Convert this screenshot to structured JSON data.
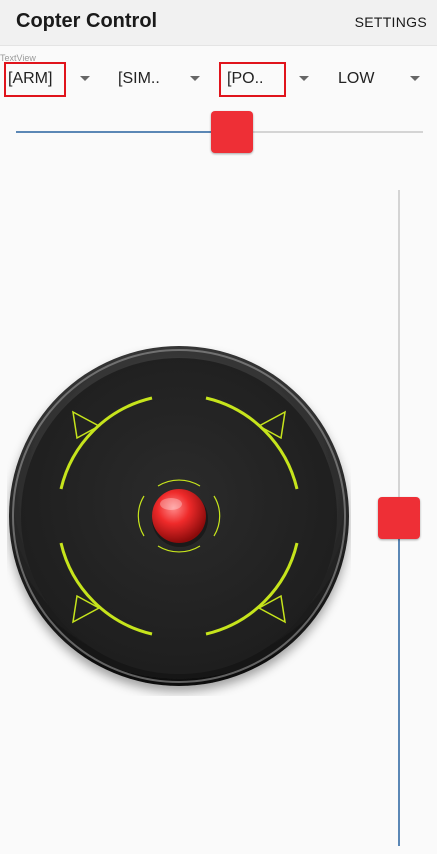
{
  "app_bar": {
    "title": "Copter Control",
    "settings_label": "SETTINGS"
  },
  "debug_label": "TextView",
  "spinners": [
    {
      "value": "[ARM]"
    },
    {
      "value": "[SIM.."
    },
    {
      "value": "[PO.."
    },
    {
      "value": "LOW"
    }
  ],
  "throttle_slider": {
    "value_fraction": 0.53
  },
  "vertical_slider": {
    "value_fraction": 0.5
  },
  "colors": {
    "accent_red": "#ee2f36",
    "track_blue": "#5b87b5",
    "joystick_green": "#c6e41c"
  },
  "icons": [
    "arrow-up-left-icon",
    "arrow-up-right-icon",
    "arrow-down-left-icon",
    "arrow-down-right-icon"
  ]
}
